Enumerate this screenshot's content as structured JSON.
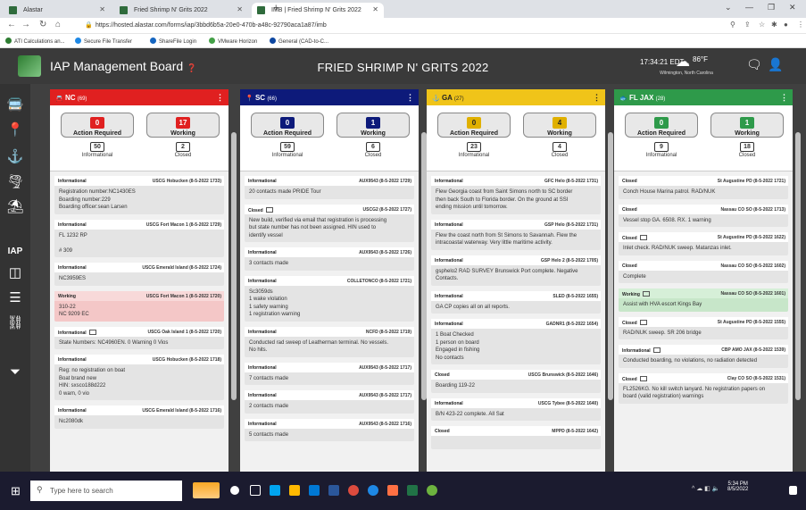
{
  "browser": {
    "tabs": [
      {
        "title": "Alastar"
      },
      {
        "title": "Fried Shrimp N' Grits 2022"
      },
      {
        "title": "IMB | Fried Shrimp N' Grits 2022"
      }
    ],
    "url": "https://hosted.alastar.com/forms/iap/3bbd6b5a-20e0-470b-a48c-92790aca1a87/imb",
    "bookmarks": [
      "ATI Calculations an...",
      "Secure File Transfer",
      "ShareFile Login",
      "VMware Horizon",
      "General (CAD-to-C..."
    ]
  },
  "header": {
    "app_title": "IAP Management Board",
    "center_title": "FRIED SHRIMP N' GRITS 2022",
    "time": "17:34:21 EDT",
    "temp": "86°F",
    "location": "Wilmington, North Carolina"
  },
  "sidebar": {
    "iap_label": "IAP"
  },
  "columns": [
    {
      "name": "NC",
      "count": "(69)",
      "color": "#e02020",
      "action_required": "0",
      "working": "17",
      "informational": "50",
      "closed": "2",
      "action_color": "#e02020",
      "working_color": "#e02020",
      "cards": [
        {
          "status": "Informational",
          "by": "USCG Hobucken (8-5-2022 1733)",
          "lines": [
            "Registration number:NC1430ES",
            "Boarding number:229",
            "Boarding officer:sean Larsen"
          ],
          "style": ""
        },
        {
          "status": "Informational",
          "by": "USCG Fort Macon 1 (8-5-2022 1729)",
          "lines": [
            "FL 1232 RP",
            "",
            "# 309"
          ],
          "style": ""
        },
        {
          "status": "Informational",
          "by": "USCG Emerald Island (8-5-2022 1724)",
          "lines": [
            "NC3959ES"
          ],
          "style": ""
        },
        {
          "status": "Working",
          "by": "USCG Fort Macon 1 (8-5-2022 1720)",
          "lines": [
            "310-22",
            "NC 9209 EC"
          ],
          "style": "pink"
        },
        {
          "status": "Informational",
          "by": "USCG Oak Island 1 (8-5-2022 1720)",
          "lines": [
            "State Numbers: NC4960EN. 0 Warning 0 Vios"
          ],
          "style": "",
          "icon": true
        },
        {
          "status": "Informational",
          "by": "USCG Hobucken (8-5-2022 1718)",
          "lines": [
            "Reg: no registration on boat",
            "Boat brand new",
            "HIN: sxsco188d222",
            "0 warn, 0 vio"
          ],
          "style": ""
        },
        {
          "status": "Informational",
          "by": "USCG Emerald Island (8-5-2022 1716)",
          "lines": [
            "Nc2080dk"
          ],
          "style": ""
        }
      ]
    },
    {
      "name": "SC",
      "count": "(66)",
      "color": "#0d1a7a",
      "action_required": "0",
      "working": "1",
      "informational": "59",
      "closed": "6",
      "action_color": "#0d1a7a",
      "working_color": "#0d1a7a",
      "cards": [
        {
          "status": "Informational",
          "by": "AUX9543 (8-5-2022 1729)",
          "lines": [
            "20 contacts made PRIDE Tour"
          ],
          "style": ""
        },
        {
          "status": "Closed",
          "by": "USCG2 (8-5-2022 1727)",
          "lines": [
            "New build, verified via email that registration is processing",
            "but state number has not been assigned. HIN used to",
            "identify vessel"
          ],
          "style": "",
          "icon": true
        },
        {
          "status": "Informational",
          "by": "AUX9543 (8-5-2022 1726)",
          "lines": [
            "3 contacts made"
          ],
          "style": ""
        },
        {
          "status": "Informational",
          "by": "COLLETONCO (8-5-2022 1721)",
          "lines": [
            "Sc3059ds",
            "1 wake violation",
            "1 safety warning",
            "1 registration warning"
          ],
          "style": ""
        },
        {
          "status": "Informational",
          "by": "NCFD (8-5-2022 1719)",
          "lines": [
            "Conducted rad sweep of Leatherman terminal. No vessels.",
            "No hits."
          ],
          "style": ""
        },
        {
          "status": "Informational",
          "by": "AUX9543 (8-5-2022 1717)",
          "lines": [
            "7 contacts made"
          ],
          "style": ""
        },
        {
          "status": "Informational",
          "by": "AUX9543 (8-5-2022 1717)",
          "lines": [
            "2 contacts made"
          ],
          "style": ""
        },
        {
          "status": "Informational",
          "by": "AUX9543 (8-5-2022 1716)",
          "lines": [
            "5 contacts made"
          ],
          "style": ""
        }
      ]
    },
    {
      "name": "GA",
      "count": "(27)",
      "color": "#f0c419",
      "action_required": "0",
      "working": "4",
      "informational": "23",
      "closed": "4",
      "action_color": "#e0b000",
      "working_color": "#e0b000",
      "cards": [
        {
          "status": "Informational",
          "by": "GFC Helo (8-5-2022 1731)",
          "lines": [
            "Flew Georgia coast from Saint Simons north to SC border",
            "then back South to Florida border. On the ground at SSI",
            "ending mission until tomorrow."
          ],
          "style": ""
        },
        {
          "status": "Informational",
          "by": "GSP Helo (8-5-2022 1731)",
          "lines": [
            "Flew the coast north from St Simons to Savannah. Flew the",
            "intracoastal waterway. Very little maritime activity."
          ],
          "style": ""
        },
        {
          "status": "Informational",
          "by": "GSP Helo 2 (8-5-2022 1705)",
          "lines": [
            "gsphelo2 RAD SURVEY Brunswick Port complete. Negative",
            "Contacts."
          ],
          "style": ""
        },
        {
          "status": "Informational",
          "by": "SLED (8-5-2022 1655)",
          "lines": [
            "GA CP copies all on all reports."
          ],
          "style": ""
        },
        {
          "status": "Informational",
          "by": "GADNR1 (8-5-2022 1654)",
          "lines": [
            "1 Boat Checked",
            "1 person on board",
            "Engaged in fishing",
            "No contacts"
          ],
          "style": ""
        },
        {
          "status": "Closed",
          "by": "USCG Brunswick (8-5-2022 1646)",
          "lines": [
            "Boarding 119-22"
          ],
          "style": ""
        },
        {
          "status": "Informational",
          "by": "USCG Tybee (8-5-2022 1640)",
          "lines": [
            "B/N 423-22 complete. All Sat"
          ],
          "style": ""
        },
        {
          "status": "Closed",
          "by": "MPPD (8-5-2022 1642)",
          "lines": [
            ""
          ],
          "style": ""
        }
      ]
    },
    {
      "name": "FL JAX",
      "count": "(28)",
      "color": "#2e9a4a",
      "action_required": "0",
      "working": "1",
      "informational": "9",
      "closed": "18",
      "action_color": "#2e9a4a",
      "working_color": "#2e9a4a",
      "cards": [
        {
          "status": "Closed",
          "by": "St Augustine PD (8-5-2022 1721)",
          "lines": [
            "Conch House Marina patrol. RAD/NUK"
          ],
          "style": ""
        },
        {
          "status": "Closed",
          "by": "Nassau CO SO (8-5-2022 1713)",
          "lines": [
            "Vessel stop GA. 6508. RX. 1 warning"
          ],
          "style": ""
        },
        {
          "status": "Closed",
          "by": "St Augustine PD (8-5-2022 1622)",
          "lines": [
            "Inlet check. RAD/NUK sweep. Matanzas inlet."
          ],
          "style": "",
          "icon": true
        },
        {
          "status": "Closed",
          "by": "Nassau CO SO (8-5-2022 1602)",
          "lines": [
            "Complete"
          ],
          "style": ""
        },
        {
          "status": "Working",
          "by": "Nassau CO SO (8-5-2022 1601)",
          "lines": [
            "Assist with HVA escort Kings Bay"
          ],
          "style": "green",
          "icon": true
        },
        {
          "status": "Closed",
          "by": "St Augustine PD (8-5-2022 1555)",
          "lines": [
            "RAD/NUK sweep. SR 206 bridge"
          ],
          "style": "",
          "icon": true
        },
        {
          "status": "Informational",
          "by": "CBP AMO JAX (8-5-2022 1539)",
          "lines": [
            "Conducted boarding, no violations, no radiation detected"
          ],
          "style": "",
          "icon": true
        },
        {
          "status": "Closed",
          "by": "Clay CO SO (8-5-2022 1531)",
          "lines": [
            "FL2526KG. No kill switch lanyard. No registration papers on",
            "board (valid registration) warnings"
          ],
          "style": "",
          "icon": true
        }
      ]
    }
  ],
  "labels": {
    "action_required": "Action Required",
    "working": "Working",
    "informational": "Informational",
    "closed": "Closed"
  },
  "taskbar": {
    "search_placeholder": "Type here to search",
    "time": "5:34 PM",
    "date": "8/5/2022"
  }
}
